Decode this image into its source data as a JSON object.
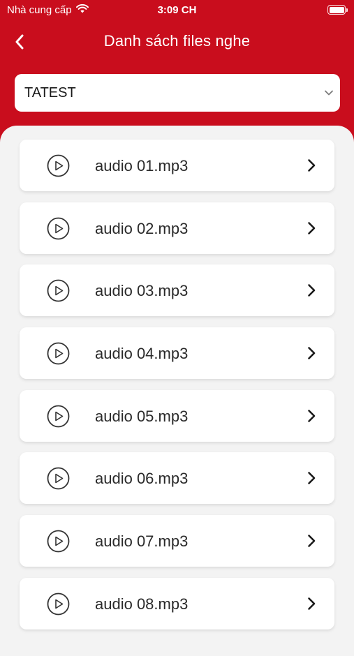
{
  "status_bar": {
    "carrier": "Nhà cung cấp",
    "time": "3:09 CH"
  },
  "nav": {
    "title": "Danh sách files nghe",
    "back_icon": "chevron-left-icon"
  },
  "selector": {
    "value": "TATEST",
    "icon": "chevron-down-icon"
  },
  "files": [
    {
      "label": "audio 01.mp3"
    },
    {
      "label": "audio 02.mp3"
    },
    {
      "label": "audio 03.mp3"
    },
    {
      "label": "audio 04.mp3"
    },
    {
      "label": "audio 05.mp3"
    },
    {
      "label": "audio 06.mp3"
    },
    {
      "label": "audio 07.mp3"
    },
    {
      "label": "audio 08.mp3"
    }
  ],
  "colors": {
    "brand": "#c90d1d",
    "background": "#f3f3f3",
    "card": "#ffffff"
  }
}
